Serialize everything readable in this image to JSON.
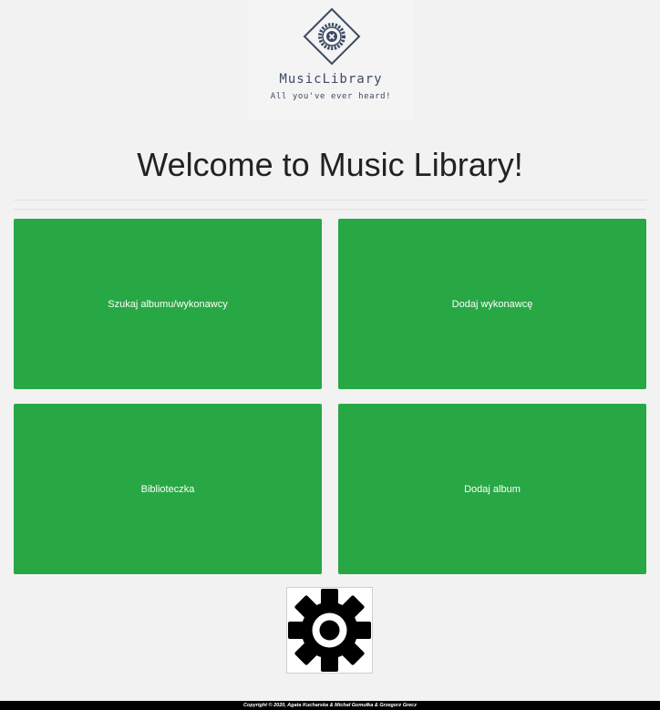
{
  "logo": {
    "name": "MusicLibrary",
    "tagline": "All you've ever heard!",
    "icon": "vinyl-record-icon"
  },
  "header": {
    "title": "Welcome to Music Library!"
  },
  "tiles": [
    {
      "label": "Szukaj albumu/wykonawcy"
    },
    {
      "label": "Dodaj wykonawcę"
    },
    {
      "label": "Biblioteczka"
    },
    {
      "label": "Dodaj album"
    }
  ],
  "settings": {
    "icon": "gear-icon"
  },
  "footer": {
    "text": "Copyright © 2020, Agata Kucharska & Michał Gomułka & Grzegorz Grecz"
  },
  "colors": {
    "tile": "#28a745",
    "logo": "#3c4a63",
    "background": "#f2f2f2",
    "footer": "#000000"
  }
}
